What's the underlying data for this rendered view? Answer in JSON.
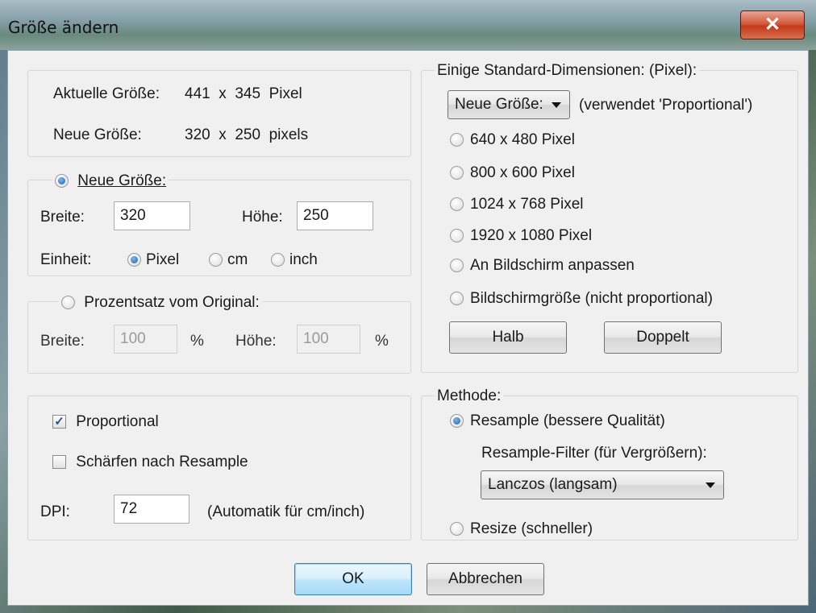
{
  "window": {
    "title": "Größe ändern",
    "close_glyph": "✕"
  },
  "info": {
    "current_label": "Aktuelle Größe:",
    "current_value": "441  x  345  Pixel",
    "new_label": "Neue Größe:",
    "new_value": "320  x  250  pixels"
  },
  "new_size": {
    "radio_label": "Neue Größe:",
    "selected": true,
    "width_label": "Breite:",
    "width_value": "320",
    "height_label": "Höhe:",
    "height_value": "250",
    "unit_label": "Einheit:",
    "units": [
      "Pixel",
      "cm",
      "inch"
    ],
    "unit_selected": "Pixel"
  },
  "percent": {
    "radio_label": "Prozentsatz vom Original:",
    "selected": false,
    "width_label": "Breite:",
    "width_value": "100",
    "width_unit": "%",
    "height_label": "Höhe:",
    "height_value": "100",
    "height_unit": "%"
  },
  "options": {
    "proportional_label": "Proportional",
    "proportional_checked": true,
    "sharpen_label": "Schärfen nach Resample",
    "sharpen_checked": false,
    "dpi_label": "DPI:",
    "dpi_value": "72",
    "dpi_note": "(Automatik für cm/inch)"
  },
  "standard": {
    "group_title": "Einige Standard-Dimensionen: (Pixel):",
    "dropdown_value": "Neue Größe:",
    "dropdown_note": "(verwendet 'Proportional')",
    "presets": [
      "640 x 480 Pixel",
      "800 x 600 Pixel",
      "1024 x 768 Pixel",
      "1920 x 1080 Pixel",
      "An Bildschirm anpassen",
      "Bildschirmgröße (nicht proportional)"
    ],
    "half_button": "Halb",
    "double_button": "Doppelt"
  },
  "method": {
    "group_title": "Methode:",
    "resample_label": "Resample (bessere Qualität)",
    "resample_selected": true,
    "filter_label": "Resample-Filter (für Vergrößern):",
    "filter_value": "Lanczos (langsam)",
    "resize_label": "Resize (schneller)",
    "resize_selected": false
  },
  "footer": {
    "ok_label": "OK",
    "cancel_label": "Abbrechen"
  },
  "colors": {
    "close_button": "#c8431f",
    "accent_radio": "#1f5fb0",
    "dialog_bg": "#f0f0f0"
  }
}
